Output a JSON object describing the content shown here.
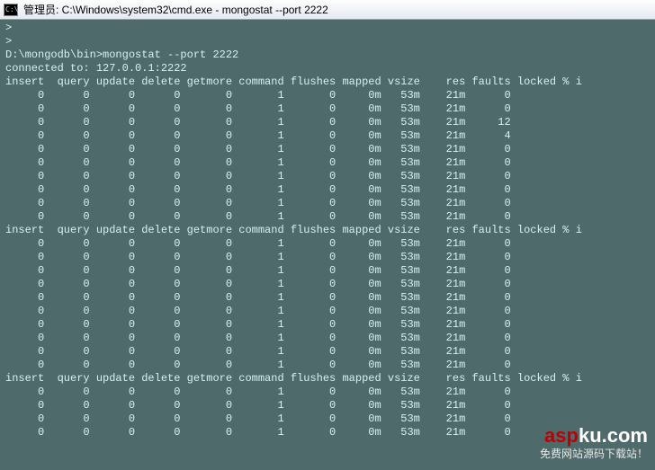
{
  "title_bar": {
    "icon_label": "C:\\",
    "title": "管理员: C:\\Windows\\system32\\cmd.exe - mongostat  --port 2222"
  },
  "terminal": {
    "prompt_lines": [
      ">",
      ">"
    ],
    "command_line": "D:\\mongodb\\bin>mongostat --port 2222",
    "connected_line": "connected to: 127.0.0.1:2222",
    "columns": [
      "insert",
      "query",
      "update",
      "delete",
      "getmore",
      "command",
      "flushes",
      "mapped",
      "vsize",
      "res",
      "faults",
      "locked",
      "% i"
    ],
    "blocks": [
      {
        "rows": [
          {
            "insert": "0",
            "query": "0",
            "update": "0",
            "delete": "0",
            "getmore": "0",
            "command": "1",
            "flushes": "0",
            "mapped": "0m",
            "vsize": "53m",
            "res": "21m",
            "faults": "0",
            "locked": ""
          },
          {
            "insert": "0",
            "query": "0",
            "update": "0",
            "delete": "0",
            "getmore": "0",
            "command": "1",
            "flushes": "0",
            "mapped": "0m",
            "vsize": "53m",
            "res": "21m",
            "faults": "0",
            "locked": ""
          },
          {
            "insert": "0",
            "query": "0",
            "update": "0",
            "delete": "0",
            "getmore": "0",
            "command": "1",
            "flushes": "0",
            "mapped": "0m",
            "vsize": "53m",
            "res": "21m",
            "faults": "12",
            "locked": ""
          },
          {
            "insert": "0",
            "query": "0",
            "update": "0",
            "delete": "0",
            "getmore": "0",
            "command": "1",
            "flushes": "0",
            "mapped": "0m",
            "vsize": "53m",
            "res": "21m",
            "faults": "4",
            "locked": ""
          },
          {
            "insert": "0",
            "query": "0",
            "update": "0",
            "delete": "0",
            "getmore": "0",
            "command": "1",
            "flushes": "0",
            "mapped": "0m",
            "vsize": "53m",
            "res": "21m",
            "faults": "0",
            "locked": ""
          },
          {
            "insert": "0",
            "query": "0",
            "update": "0",
            "delete": "0",
            "getmore": "0",
            "command": "1",
            "flushes": "0",
            "mapped": "0m",
            "vsize": "53m",
            "res": "21m",
            "faults": "0",
            "locked": ""
          },
          {
            "insert": "0",
            "query": "0",
            "update": "0",
            "delete": "0",
            "getmore": "0",
            "command": "1",
            "flushes": "0",
            "mapped": "0m",
            "vsize": "53m",
            "res": "21m",
            "faults": "0",
            "locked": ""
          },
          {
            "insert": "0",
            "query": "0",
            "update": "0",
            "delete": "0",
            "getmore": "0",
            "command": "1",
            "flushes": "0",
            "mapped": "0m",
            "vsize": "53m",
            "res": "21m",
            "faults": "0",
            "locked": ""
          },
          {
            "insert": "0",
            "query": "0",
            "update": "0",
            "delete": "0",
            "getmore": "0",
            "command": "1",
            "flushes": "0",
            "mapped": "0m",
            "vsize": "53m",
            "res": "21m",
            "faults": "0",
            "locked": ""
          },
          {
            "insert": "0",
            "query": "0",
            "update": "0",
            "delete": "0",
            "getmore": "0",
            "command": "1",
            "flushes": "0",
            "mapped": "0m",
            "vsize": "53m",
            "res": "21m",
            "faults": "0",
            "locked": ""
          }
        ]
      },
      {
        "rows": [
          {
            "insert": "0",
            "query": "0",
            "update": "0",
            "delete": "0",
            "getmore": "0",
            "command": "1",
            "flushes": "0",
            "mapped": "0m",
            "vsize": "53m",
            "res": "21m",
            "faults": "0",
            "locked": ""
          },
          {
            "insert": "0",
            "query": "0",
            "update": "0",
            "delete": "0",
            "getmore": "0",
            "command": "1",
            "flushes": "0",
            "mapped": "0m",
            "vsize": "53m",
            "res": "21m",
            "faults": "0",
            "locked": ""
          },
          {
            "insert": "0",
            "query": "0",
            "update": "0",
            "delete": "0",
            "getmore": "0",
            "command": "1",
            "flushes": "0",
            "mapped": "0m",
            "vsize": "53m",
            "res": "21m",
            "faults": "0",
            "locked": ""
          },
          {
            "insert": "0",
            "query": "0",
            "update": "0",
            "delete": "0",
            "getmore": "0",
            "command": "1",
            "flushes": "0",
            "mapped": "0m",
            "vsize": "53m",
            "res": "21m",
            "faults": "0",
            "locked": ""
          },
          {
            "insert": "0",
            "query": "0",
            "update": "0",
            "delete": "0",
            "getmore": "0",
            "command": "1",
            "flushes": "0",
            "mapped": "0m",
            "vsize": "53m",
            "res": "21m",
            "faults": "0",
            "locked": ""
          },
          {
            "insert": "0",
            "query": "0",
            "update": "0",
            "delete": "0",
            "getmore": "0",
            "command": "1",
            "flushes": "0",
            "mapped": "0m",
            "vsize": "53m",
            "res": "21m",
            "faults": "0",
            "locked": ""
          },
          {
            "insert": "0",
            "query": "0",
            "update": "0",
            "delete": "0",
            "getmore": "0",
            "command": "1",
            "flushes": "0",
            "mapped": "0m",
            "vsize": "53m",
            "res": "21m",
            "faults": "0",
            "locked": ""
          },
          {
            "insert": "0",
            "query": "0",
            "update": "0",
            "delete": "0",
            "getmore": "0",
            "command": "1",
            "flushes": "0",
            "mapped": "0m",
            "vsize": "53m",
            "res": "21m",
            "faults": "0",
            "locked": ""
          },
          {
            "insert": "0",
            "query": "0",
            "update": "0",
            "delete": "0",
            "getmore": "0",
            "command": "1",
            "flushes": "0",
            "mapped": "0m",
            "vsize": "53m",
            "res": "21m",
            "faults": "0",
            "locked": ""
          },
          {
            "insert": "0",
            "query": "0",
            "update": "0",
            "delete": "0",
            "getmore": "0",
            "command": "1",
            "flushes": "0",
            "mapped": "0m",
            "vsize": "53m",
            "res": "21m",
            "faults": "0",
            "locked": ""
          }
        ]
      },
      {
        "rows": [
          {
            "insert": "0",
            "query": "0",
            "update": "0",
            "delete": "0",
            "getmore": "0",
            "command": "1",
            "flushes": "0",
            "mapped": "0m",
            "vsize": "53m",
            "res": "21m",
            "faults": "0",
            "locked": ""
          },
          {
            "insert": "0",
            "query": "0",
            "update": "0",
            "delete": "0",
            "getmore": "0",
            "command": "1",
            "flushes": "0",
            "mapped": "0m",
            "vsize": "53m",
            "res": "21m",
            "faults": "0",
            "locked": ""
          },
          {
            "insert": "0",
            "query": "0",
            "update": "0",
            "delete": "0",
            "getmore": "0",
            "command": "1",
            "flushes": "0",
            "mapped": "0m",
            "vsize": "53m",
            "res": "21m",
            "faults": "0",
            "locked": ""
          },
          {
            "insert": "0",
            "query": "0",
            "update": "0",
            "delete": "0",
            "getmore": "0",
            "command": "1",
            "flushes": "0",
            "mapped": "0m",
            "vsize": "53m",
            "res": "21m",
            "faults": "0",
            "locked": ""
          }
        ]
      }
    ]
  },
  "watermark": {
    "url_asp": "asp",
    "url_ku": "ku",
    "url_dot": ".com",
    "tagline": "免费网站源码下载站！"
  }
}
